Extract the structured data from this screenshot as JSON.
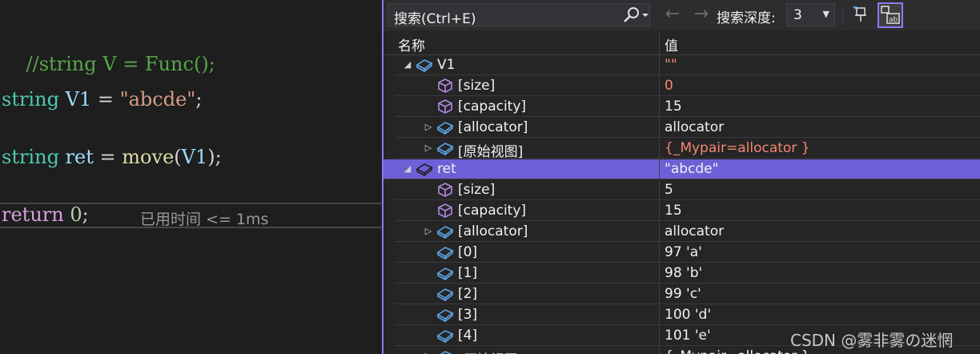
{
  "editor": {
    "line1": {
      "comment": "//string V = Func();"
    },
    "line2": {
      "type": "string",
      "var": "V1",
      "eq": "=",
      "str": "\"abcde\"",
      "semi": ";"
    },
    "line3": {
      "type": "string",
      "var": "ret",
      "eq": "=",
      "fn": "move",
      "open": "(",
      "arg": "V1",
      "close": ");"
    },
    "line4": {
      "kw": "return",
      "num": "0",
      "semi": ";",
      "perf_tip": "已用时间 <= 1ms"
    }
  },
  "watch": {
    "search_placeholder": "搜索(Ctrl+E)",
    "search_depth_label": "搜索深度:",
    "search_depth_value": "3",
    "back_glyph": "←",
    "forward_glyph": "→",
    "column_name": "名称",
    "column_value": "值",
    "rows": [
      {
        "name": "V1",
        "value": "\"\"",
        "icon": "object-icon",
        "expander": "expanded",
        "changed": true
      },
      {
        "name": "[size]",
        "value": "0",
        "icon": "field-icon",
        "expander": "none",
        "changed": true
      },
      {
        "name": "[capacity]",
        "value": "15",
        "icon": "field-icon",
        "expander": "none",
        "changed": false
      },
      {
        "name": "[allocator]",
        "value": "allocator",
        "icon": "object-icon",
        "expander": "collapsed",
        "changed": false
      },
      {
        "name": "[原始视图]",
        "value": "{_Mypair=allocator }",
        "icon": "object-icon",
        "expander": "collapsed",
        "changed": true
      },
      {
        "name": "ret",
        "value": "\"abcde\"",
        "icon": "object-icon",
        "expander": "expanded",
        "changed": false,
        "selected": true
      },
      {
        "name": "[size]",
        "value": "5",
        "icon": "field-icon",
        "expander": "none",
        "changed": false
      },
      {
        "name": "[capacity]",
        "value": "15",
        "icon": "field-icon",
        "expander": "none",
        "changed": false
      },
      {
        "name": "[allocator]",
        "value": "allocator",
        "icon": "object-icon",
        "expander": "collapsed",
        "changed": false
      },
      {
        "name": "[0]",
        "value": "97 'a'",
        "icon": "object-icon",
        "expander": "none",
        "changed": false
      },
      {
        "name": "[1]",
        "value": "98 'b'",
        "icon": "object-icon",
        "expander": "none",
        "changed": false
      },
      {
        "name": "[2]",
        "value": "99 'c'",
        "icon": "object-icon",
        "expander": "none",
        "changed": false
      },
      {
        "name": "[3]",
        "value": "100 'd'",
        "icon": "object-icon",
        "expander": "none",
        "changed": false
      },
      {
        "name": "[4]",
        "value": "101 'e'",
        "icon": "object-icon",
        "expander": "none",
        "changed": false
      },
      {
        "name": "[原始视图]",
        "value": "{_Mypair=allocator }",
        "icon": "object-icon",
        "expander": "collapsed",
        "changed": false
      }
    ]
  },
  "watermark": "CSDN @雾非雾の迷惘",
  "colors": {
    "accent": "#8a7bf0",
    "selection": "#6e5fd6",
    "changed_value": "#f48771",
    "object_icon": "#5ea6e6",
    "field_icon": "#b48be0"
  }
}
